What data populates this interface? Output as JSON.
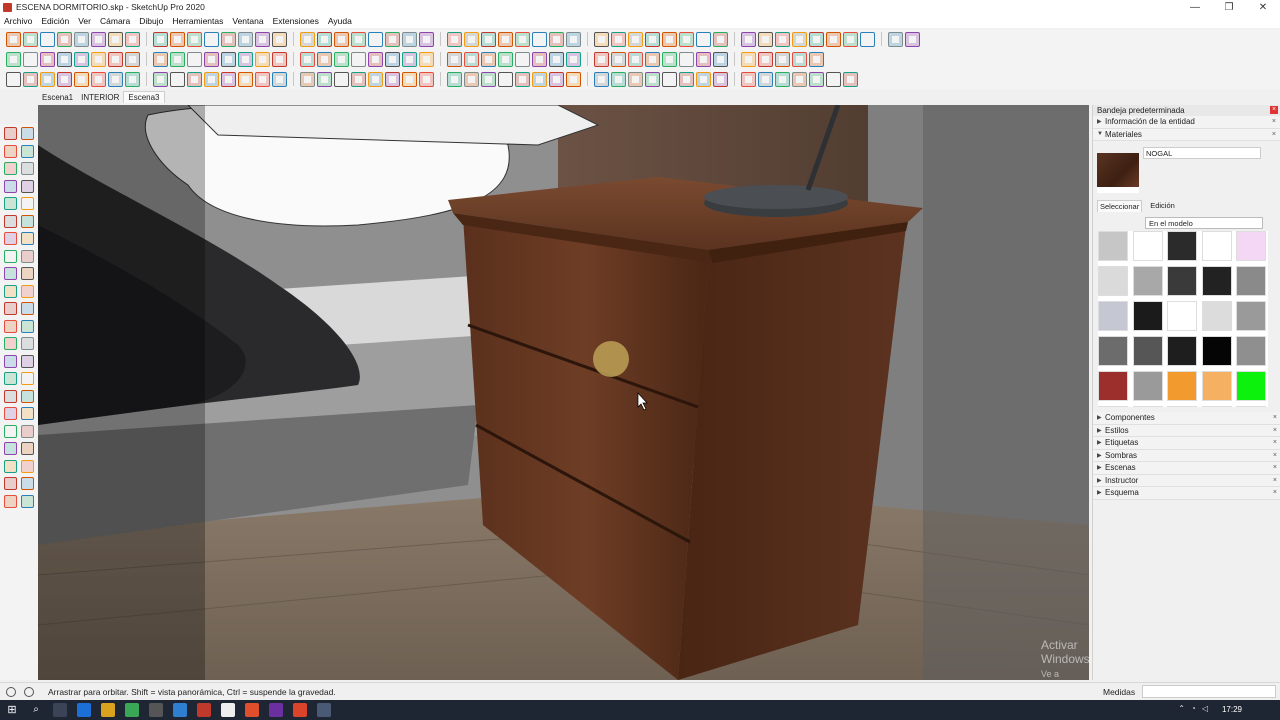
{
  "window": {
    "title": "ESCENA DORMITORIO.skp - SketchUp Pro 2020",
    "minimize": "—",
    "maximize": "❐",
    "close": "✕"
  },
  "menu": [
    "Archivo",
    "Edición",
    "Ver",
    "Cámara",
    "Dibujo",
    "Herramientas",
    "Ventana",
    "Extensiones",
    "Ayuda"
  ],
  "scenes": {
    "tabs": [
      "Escena1",
      "INTERIOR",
      "Escena3"
    ],
    "active": 2
  },
  "watermark": {
    "line1": "Activar Windows",
    "line2": "Ve a Configuración para activar Windows."
  },
  "tray": {
    "title": "Bandeja predeterminada",
    "entity_info": "Información de la entidad",
    "materials": "Materiales",
    "material_name": "NOGAL",
    "tab_select": "Seleccionar",
    "tab_edit": "Edición",
    "dropdown_value": "En el modelo",
    "panels": [
      "Componentes",
      "Estilos",
      "Etiquetas",
      "Sombras",
      "Escenas",
      "Instructor",
      "Esquema"
    ]
  },
  "swatch_colors": [
    "#c6c6c6",
    "#ffffff",
    "#2b2b2b",
    "#ffffff",
    "#f3d7f5",
    "#dadada",
    "#a8a8a8",
    "#3a3a3a",
    "#222222",
    "#8a8a8a",
    "#c5c8d3",
    "#1b1b1b",
    "#ffffff",
    "#dcdcdc",
    "#9a9a9a",
    "#6c6c6c",
    "#565656",
    "#1e1e1e",
    "#050505",
    "#8f8f8f",
    "#9c2f2b",
    "#9a9a9a",
    "#f29a2e",
    "#f6b061",
    "#0cf20c",
    "#b07c64",
    "#5b5b5b",
    "#4a4a4a",
    "#b9a995",
    "#a0612f"
  ],
  "status": {
    "text": "Arrastrar para orbitar. Shift = vista panorámica, Ctrl = suspende la gravedad.",
    "measure_label": "Medidas"
  },
  "taskbar": {
    "time": "17:29"
  }
}
